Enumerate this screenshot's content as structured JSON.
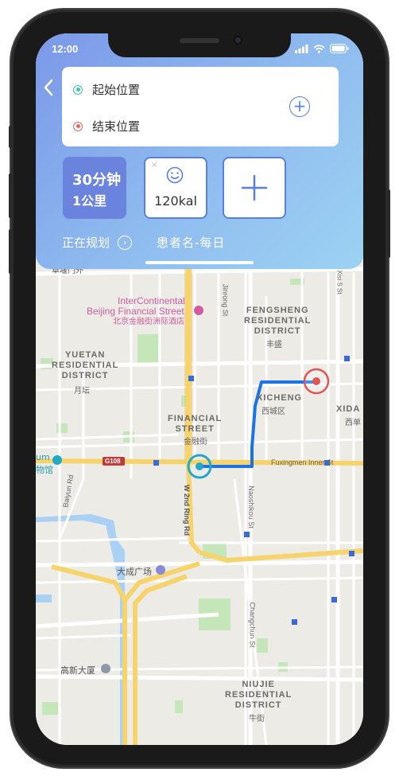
{
  "status_bar": {
    "time": "12:00"
  },
  "route": {
    "start_label": "起始位置",
    "end_label": "结束位置",
    "duration": "30分钟",
    "distance": "1公里",
    "calories": "120kal",
    "planning_label": "正在规划",
    "patient_label": "患者名-每日"
  },
  "map": {
    "labels": {
      "intercontinental_en1": "InterContinental",
      "intercontinental_en2": "Beijing Financial Street",
      "intercontinental_cn": "北京金融街洲际酒店",
      "fengsheng": [
        "FENGSHENG",
        "RESIDENTIAL",
        "DISTRICT"
      ],
      "fengsheng_cn": "丰盛",
      "yuetan": [
        "YUETAN",
        "RESIDENTIAL",
        "DISTRICT"
      ],
      "yuetan_cn": "月坛",
      "xicheng": "XICHENG",
      "xicheng_cn": "西城区",
      "xidan": "XIDA",
      "xidan_cn": "西单",
      "financial": [
        "FINANCIAL",
        "STREET"
      ],
      "financial_cn": "金融街",
      "museum": "um",
      "museum_cn": "物馆",
      "g108": "G108",
      "fuxingmen": "Fuxingmen Inner St",
      "w2ring": "W 2nd Ring Rd",
      "baiyun": "Baiyun Rd",
      "jinrong": "Jinrong St",
      "naoshikou": "Naoshikou St",
      "changchun": "Changchun St",
      "xisi": "Xisi S St",
      "dacheng": "大成广场",
      "gaoxin": "高新大厦",
      "niujie": [
        "NIUJIE",
        "RESIDENTIAL",
        "DISTRICT"
      ],
      "niujie_cn": "牛街",
      "top_cut": "草堰门外"
    }
  },
  "colors": {
    "route": "#1a73e8",
    "start": "#22a9c9",
    "end": "#e05555",
    "panel_start": "#7b98e8",
    "panel_end": "#9dd2f3"
  }
}
